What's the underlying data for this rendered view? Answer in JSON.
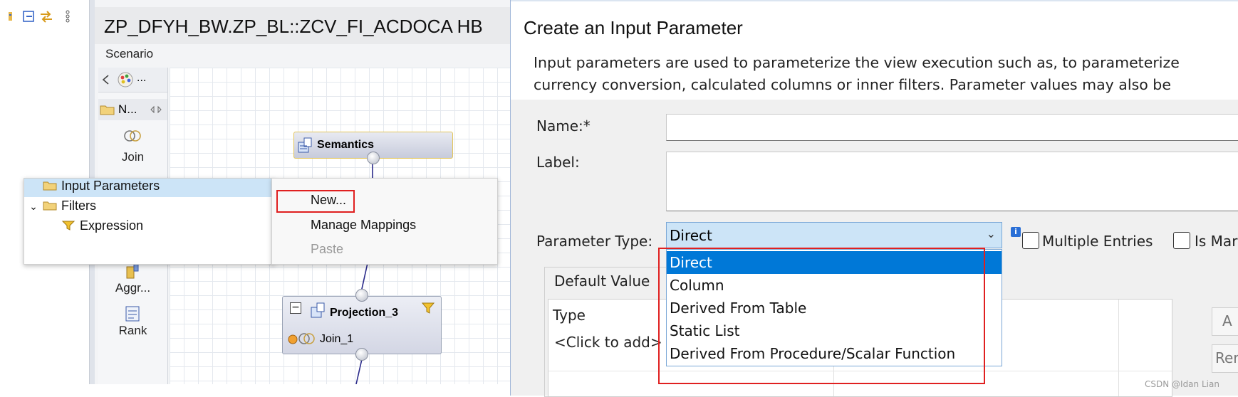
{
  "editor": {
    "title": "ZP_DFYH_BW.ZP_BL::ZCV_FI_ACDOCA HB",
    "scenario_label": "Scenario",
    "palette_head_label": "N...",
    "palette_sub_label": "...",
    "palette_items": [
      {
        "label": "Join"
      },
      {
        "label": "Aggr..."
      },
      {
        "label": "Rank"
      }
    ],
    "nodes": {
      "semantics": "Semantics",
      "projection": "Projection_3",
      "projection_sub": "Join_1"
    }
  },
  "tree_popup": {
    "rows": [
      {
        "label": "Input Parameters"
      },
      {
        "label": "Filters"
      },
      {
        "label": "Expression"
      }
    ]
  },
  "context_menu": {
    "items": [
      {
        "label": "New..."
      },
      {
        "label": "Manage Mappings"
      },
      {
        "label": "Paste"
      }
    ]
  },
  "dialog": {
    "title": "Create an Input Parameter",
    "description": "Input parameters are used to parameterize the view execution such as, to parameterize\ncurrency conversion, calculated columns or inner filters. Parameter values may also be",
    "name_label": "Name:*",
    "label_label": "Label:",
    "parameter_type_label": "Parameter Type:",
    "parameter_type_value": "Direct",
    "multiple_entries_label": "Multiple Entries",
    "is_mandatory_label": "Is Mar",
    "info_label": "i",
    "default_value_label": "Default Value",
    "type_header": "Type",
    "click_to_add": "<Click to add>",
    "side_button_1": "A",
    "side_button_2": "Rer",
    "dropdown_options": [
      "Direct",
      "Column",
      "Derived From Table",
      "Static List",
      "Derived From Procedure/Scalar Function"
    ]
  },
  "watermark": "CSDN @Idan Lian",
  "colors": {
    "selection_blue": "#0078d7",
    "highlight_red": "#e02020",
    "tree_selection": "#cce4f7"
  }
}
